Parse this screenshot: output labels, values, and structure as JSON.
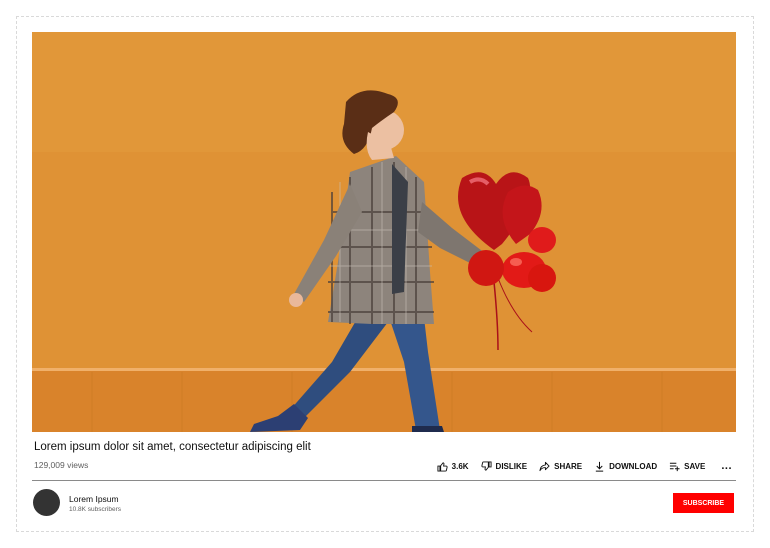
{
  "video": {
    "title": "Lorem ipsum dolor sit amet, consectetur adipiscing elit",
    "views": "129,009 views",
    "thumbnail_colors": {
      "wall": "#df9235",
      "skirting": "#d9832b",
      "balloon": "#d8160f"
    }
  },
  "actions": {
    "like_count": "3.6K",
    "dislike_label": "DISLIKE",
    "share_label": "SHARE",
    "download_label": "DOWNLOAD",
    "save_label": "SAVE",
    "more_label": "..."
  },
  "channel": {
    "name": "Lorem Ipsum",
    "subscribers": "10.8K subscribers"
  },
  "subscribe_label": "SUBSCRIBE",
  "colors": {
    "accent": "#ff0000",
    "text": "#0f0f0f",
    "secondary_text": "#606060"
  }
}
